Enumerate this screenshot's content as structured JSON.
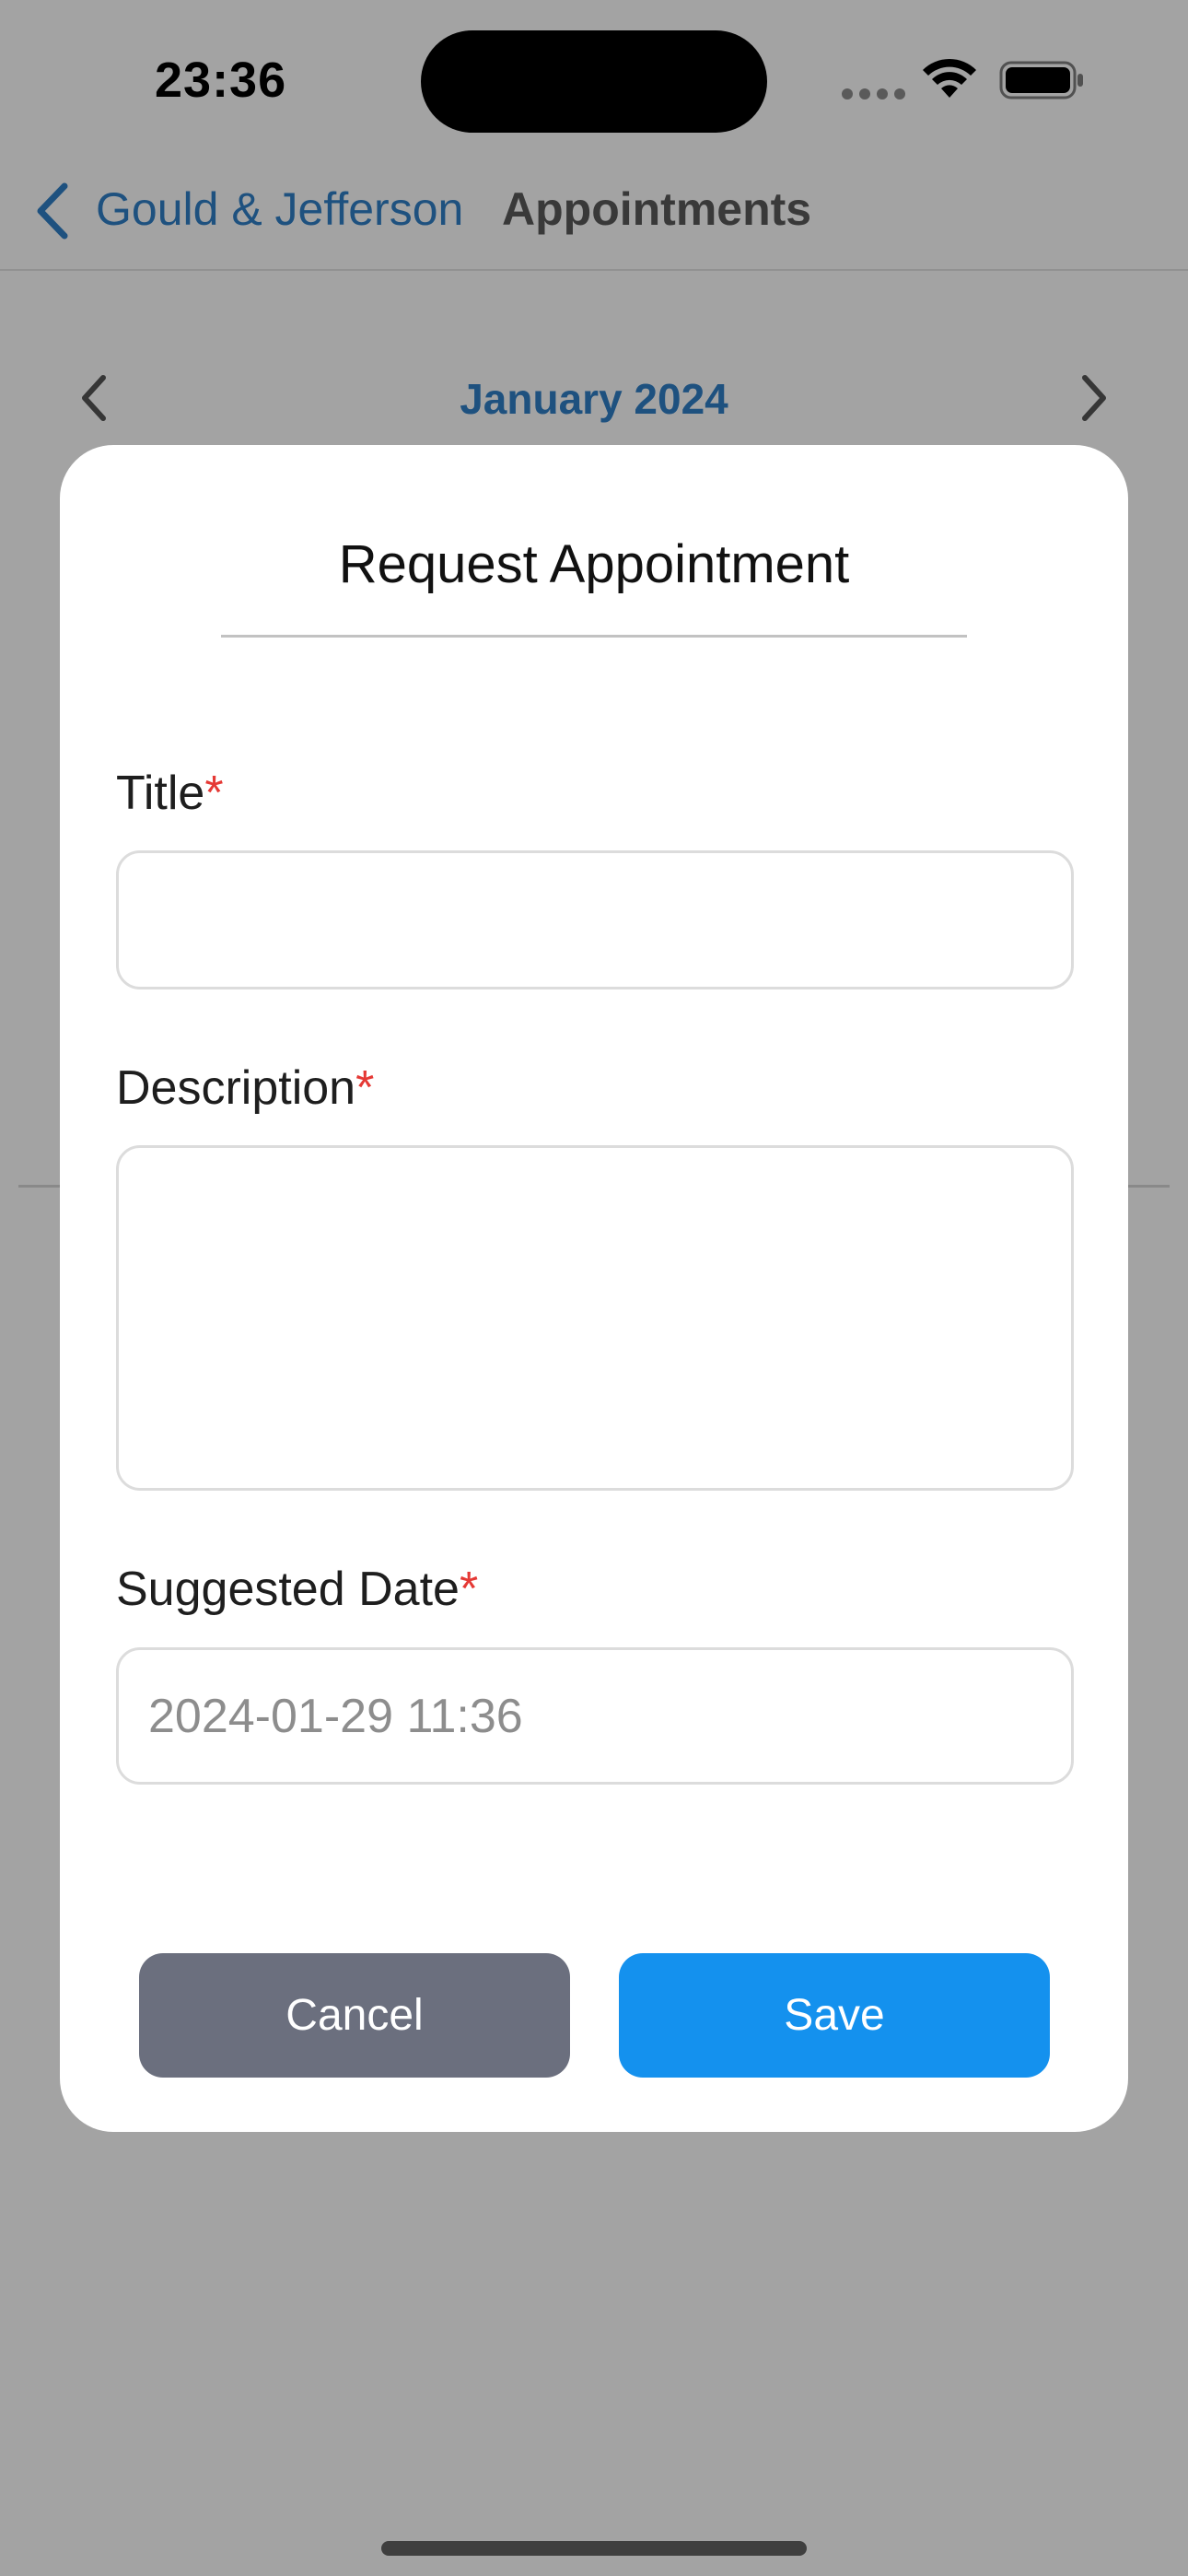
{
  "status_bar": {
    "time": "23:36"
  },
  "nav": {
    "back_label": "Gould & Jefferson",
    "title": "Appointments"
  },
  "calendar": {
    "month_label": "January 2024"
  },
  "modal": {
    "title": "Request Appointment",
    "fields": {
      "title": {
        "label": "Title",
        "required_mark": "*",
        "value": ""
      },
      "description": {
        "label": "Description",
        "required_mark": "*",
        "value": ""
      },
      "suggested_date": {
        "label": "Suggested Date",
        "required_mark": "*",
        "placeholder": "2024-01-29 11:36",
        "value": ""
      }
    },
    "buttons": {
      "cancel": "Cancel",
      "save": "Save"
    }
  },
  "colors": {
    "accent_blue": "#1491ee",
    "cancel_gray": "#6b6f7e",
    "required_red": "#e53935",
    "link_blue": "#2f7fc7"
  },
  "icons": {
    "back": "chevron-left-icon",
    "calendar_prev": "chevron-left-icon",
    "calendar_next": "chevron-right-icon",
    "wifi": "wifi-icon",
    "battery": "battery-icon"
  }
}
